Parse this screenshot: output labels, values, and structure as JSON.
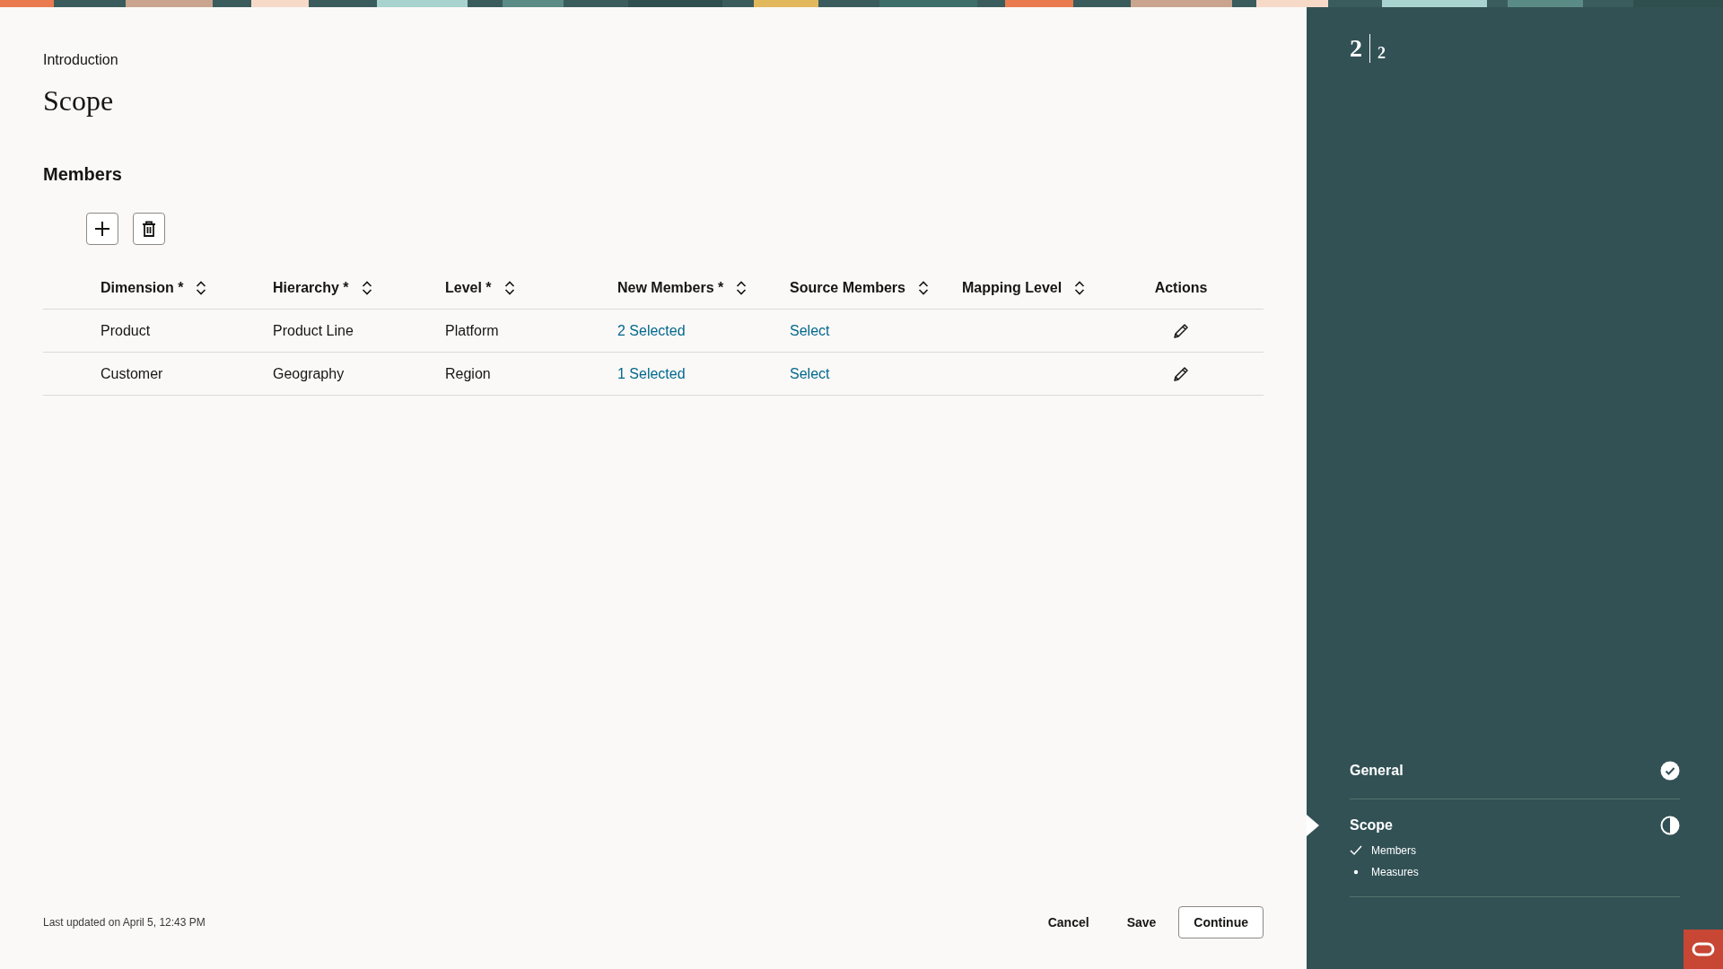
{
  "breadcrumb": "Introduction",
  "title": "Scope",
  "section": "Members",
  "toolbar": [
    {
      "kind": "add"
    },
    {
      "kind": "delete"
    }
  ],
  "table": {
    "columns": [
      {
        "label": "Dimension *",
        "sortable": true
      },
      {
        "label": "Hierarchy *",
        "sortable": true
      },
      {
        "label": "Level *",
        "sortable": true
      },
      {
        "label": "New Members *",
        "sortable": true
      },
      {
        "label": "Source Members",
        "sortable": true
      },
      {
        "label": "Mapping Level",
        "sortable": true
      },
      {
        "label": "Actions",
        "sortable": false
      }
    ],
    "rows": [
      {
        "cells": [
          {
            "kind": "text",
            "text": "Product"
          },
          {
            "kind": "text",
            "text": "Product Line"
          },
          {
            "kind": "text",
            "text": "Platform"
          },
          {
            "kind": "link",
            "text": "2 Selected"
          },
          {
            "kind": "link",
            "text": "Select"
          },
          {
            "kind": "empty"
          },
          {
            "kind": "edit"
          }
        ]
      },
      {
        "cells": [
          {
            "kind": "text",
            "text": "Customer"
          },
          {
            "kind": "text",
            "text": "Geography"
          },
          {
            "kind": "text",
            "text": "Region"
          },
          {
            "kind": "link",
            "text": "1 Selected"
          },
          {
            "kind": "link",
            "text": "Select"
          },
          {
            "kind": "empty"
          },
          {
            "kind": "edit"
          }
        ]
      }
    ]
  },
  "footer": {
    "updated": "Last updated on April 5, 12:43 PM",
    "buttons": [
      {
        "label": "Cancel",
        "kind": "borderless"
      },
      {
        "label": "Save",
        "kind": "borderless"
      },
      {
        "label": "Continue",
        "kind": "outlined"
      }
    ]
  },
  "progress": {
    "current": "2",
    "total": "2"
  },
  "steps": [
    {
      "label": "General",
      "kind": "complete",
      "selected": false
    },
    {
      "label": "Scope",
      "kind": "partial",
      "selected": true,
      "children": [
        {
          "label": "Members",
          "done": true
        },
        {
          "label": "Measures",
          "done": false
        }
      ]
    }
  ]
}
